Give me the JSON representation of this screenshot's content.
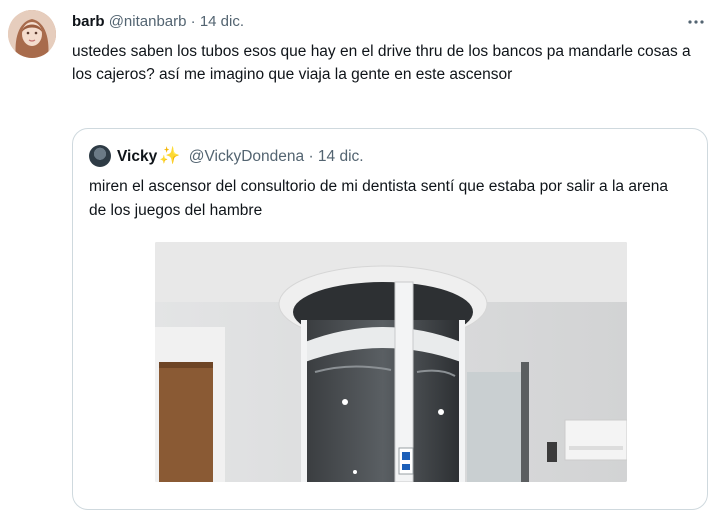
{
  "tweet": {
    "display_name": "barb",
    "handle": "@nitanbarb",
    "separator": "·",
    "date": "14 dic.",
    "more_icon": "more-icon",
    "text": "ustedes saben los tubos esos que hay en el drive thru de los bancos pa mandarle cosas a los cajeros? así me imagino que viaja la gente en este ascensor"
  },
  "quoted": {
    "display_name": "Vicky",
    "emoji": "✨",
    "handle": "@VickyDondena",
    "separator": "·",
    "date": "14 dic.",
    "text": "miren el ascensor del consultorio de mi dentista sentí que estaba por salir a la arena de los juegos del hambre"
  }
}
